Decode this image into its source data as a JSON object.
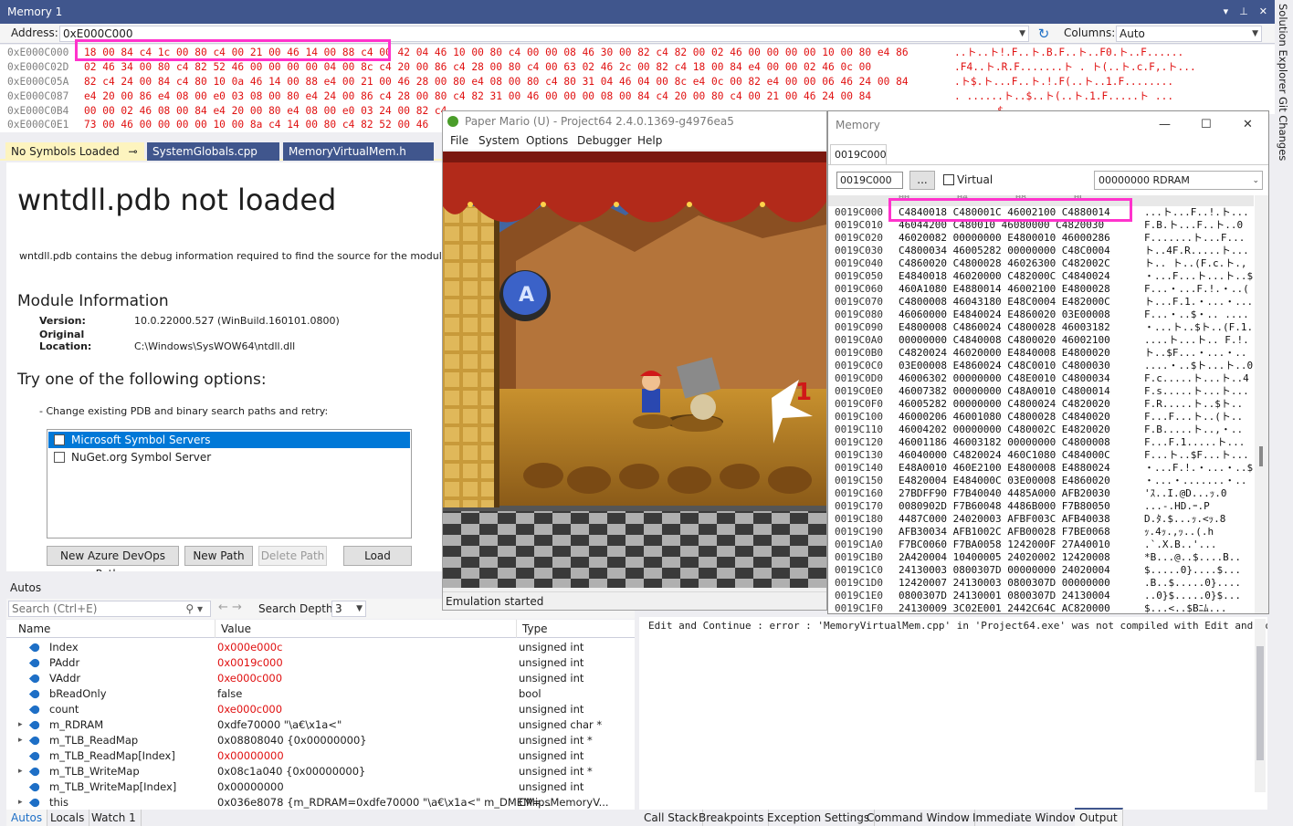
{
  "memory1": {
    "title": "Memory 1",
    "address_label": "Address:",
    "address_value": "0xE000C000",
    "columns_label": "Columns:",
    "columns_value": "Auto",
    "rows": [
      {
        "addr": "0xE000C000",
        "bytes": "18 00 84 c4 1c 00 80 c4 00 21 00 46 14 00 88 c4 00 42 04 46 10 00 80 c4 00 00 08 46 30 00 82 c4 82 00 02 46 00 00 00 00 10 00 80 e4 86",
        "chars": "..ト..ト!.F..ト.B.F..ト..F0.ト..F......"
      },
      {
        "addr": "0xE000C02D",
        "bytes": "02 46 34 00 80 c4 82 52 46 00 00 00 00 04 00 8c c4 20 00 86 c4 28 00 80 c4 00 63 02 46 2c 00 82 c4 18 00 84 e4 00 00 02 46 0c 00",
        "chars": ".F4..ト.R.F.......ト . ト(..ト.c.F,.ト..."
      },
      {
        "addr": "0xE000C05A",
        "bytes": "82 c4 24 00 84 c4 80 10 0a 46 14 00 88 e4 00 21 00 46 28 00 80 e4 08 00 80 c4 80 31 04 46 04 00 8c e4 0c 00 82 e4 00 00 06 46 24 00 84",
        "chars": ".ト$.ト...F..ト.!.F(..ト..1.F........"
      },
      {
        "addr": "0xE000C087",
        "bytes": "e4 20 00 86 e4 08 00 e0 03 08 00 80 e4 24 00 86 c4 28 00 80 c4 82 31 00 46 00 00 00 08 00 84 c4 20 00 80 c4 00 21 00 46 24 00 84",
        "chars": ". ......ト..$..ト(..ト.1.F.....ト ..."
      },
      {
        "addr": "0xE000C0B4",
        "bytes": "00 00 02 46 08 00 84 e4 20 00 80 e4 08 00 e0 03 24 00 82 c4",
        "chars": ".......$......"
      },
      {
        "addr": "0xE000C0E1",
        "bytes": "73 00 46 00 00 00 00 10 00 8a c4 14 00 80 c4 82 52 00 46",
        "chars": "s.F......ト...ト.R.F"
      }
    ]
  },
  "doc_tabs": [
    {
      "label": "No Symbols Loaded"
    },
    {
      "label": "SystemGlobals.cpp"
    },
    {
      "label": "MemoryVirtualMem.h"
    }
  ],
  "nosymbols": {
    "title": "wntdll.pdb not loaded",
    "description": "wntdll.pdb contains the debug information required to find the source for the module n",
    "module_info_heading": "Module Information",
    "version_label": "Version:",
    "version_value": "10.0.22000.527 (WinBuild.160101.0800)",
    "location_label": "Original Location:",
    "location_value": "C:\\Windows\\SysWOW64\\ntdll.dll",
    "options_heading": "Try one of the following options:",
    "change_pdb": "-  Change existing PDB and binary search paths and retry:",
    "symbol_servers": [
      "Microsoft Symbol Servers",
      "NuGet.org Symbol Server"
    ],
    "buttons": {
      "devops": "New Azure DevOps Path...",
      "new_path": "New Path",
      "delete_path": "Delete Path",
      "load": "Load"
    }
  },
  "autos": {
    "title": "Autos",
    "search_placeholder": "Search (Ctrl+E)",
    "depth_label": "Search Depth:",
    "depth_value": "3",
    "columns": [
      "Name",
      "Value",
      "Type"
    ],
    "rows": [
      {
        "name": "Index",
        "value": "0x000e000c",
        "type": "unsigned int",
        "red": true,
        "expand": ""
      },
      {
        "name": "PAddr",
        "value": "0x0019c000",
        "type": "unsigned int",
        "red": true,
        "expand": ""
      },
      {
        "name": "VAddr",
        "value": "0xe000c000",
        "type": "unsigned int",
        "red": true,
        "expand": ""
      },
      {
        "name": "bReadOnly",
        "value": "false",
        "type": "bool",
        "red": false,
        "expand": ""
      },
      {
        "name": "count",
        "value": "0xe000c000",
        "type": "unsigned int",
        "red": true,
        "expand": ""
      },
      {
        "name": "m_RDRAM",
        "value": "0xdfe70000 \"\\a€\\x1a<\"",
        "type": "unsigned char *",
        "red": false,
        "expand": "▸"
      },
      {
        "name": "m_TLB_ReadMap",
        "value": "0x08808040 {0x00000000}",
        "type": "unsigned int *",
        "red": false,
        "expand": "▸"
      },
      {
        "name": "m_TLB_ReadMap[Index]",
        "value": "0x00000000",
        "type": "unsigned int",
        "red": true,
        "expand": ""
      },
      {
        "name": "m_TLB_WriteMap",
        "value": "0x08c1a040 {0x00000000}",
        "type": "unsigned int *",
        "red": false,
        "expand": "▸"
      },
      {
        "name": "m_TLB_WriteMap[Index]",
        "value": "0x00000000",
        "type": "unsigned int",
        "red": false,
        "expand": ""
      },
      {
        "name": "this",
        "value": "0x036e8078 {m_RDRAM=0xdfe70000 \"\\a€\\x1a<\" m_DMEM=...",
        "type": "CMipsMemoryV...",
        "red": false,
        "expand": "▸"
      }
    ],
    "tabs": [
      "Autos",
      "Locals",
      "Watch 1"
    ]
  },
  "output": {
    "line": "Edit and Continue : error  : 'MemoryVirtualMem.cpp' in 'Project64.exe' was not compiled with Edit and Continue"
  },
  "bottom_tabs": [
    "Call Stack",
    "Breakpoints",
    "Exception Settings",
    "Command Window",
    "Immediate Window",
    "Output"
  ],
  "side_tabs": [
    "Solution Explorer",
    "Git Changes"
  ],
  "pj64": {
    "title": "Paper Mario (U) - Project64 2.4.0.1369-g4976ea5",
    "menu": [
      "File",
      "System",
      "Options",
      "Debugger",
      "Help"
    ],
    "status": "Emulation started"
  },
  "memwin": {
    "title": "Memory",
    "tab": "0019C000",
    "address": "0019C000",
    "dots": "...",
    "virtual_label": "Virtual",
    "region": "00000000 RDRAM",
    "col_headers": [
      "00",
      "04",
      "08",
      "0C"
    ],
    "rows": [
      {
        "addr": "0019C000",
        "data": "C4840018 C480001C 46002100 C4880014",
        "chars": "...ト...F..!.ト..."
      },
      {
        "addr": "0019C010",
        "data": "46044200 C480010 46080000 C4820030",
        "chars": "F.B.ト...F..ト..0"
      },
      {
        "addr": "0019C020",
        "data": "46020082 00000000 E4800010 46000286",
        "chars": "F.......ト...F..."
      },
      {
        "addr": "0019C030",
        "data": "C4800034 46005282 00000000 C48C0004",
        "chars": "ト..4F.R.....ト..."
      },
      {
        "addr": "0019C040",
        "data": "C4860020 C4800028 46026300 C482002C",
        "chars": "ト.. ト..(F.c.ト.,"
      },
      {
        "addr": "0019C050",
        "data": "E4840018 46020000 C482000C C4840024",
        "chars": "・...F...ト...ト..$"
      },
      {
        "addr": "0019C060",
        "data": "460A1080 E4880014 46002100 E4800028",
        "chars": "F...・...F.!.・..("
      },
      {
        "addr": "0019C070",
        "data": "C4800008 46043180 E48C0004 E482000C",
        "chars": "ト...F.1.・...・..."
      },
      {
        "addr": "0019C080",
        "data": "46060000 E4840024 E4860020 03E00008",
        "chars": "F...・..$・.. ...."
      },
      {
        "addr": "0019C090",
        "data": "E4800008 C4860024 C4800028 46003182",
        "chars": "・...ト..$ト..(F.1."
      },
      {
        "addr": "0019C0A0",
        "data": "00000000 C4840008 C4800020 46002100",
        "chars": "....ト...ト.. F.!."
      },
      {
        "addr": "0019C0B0",
        "data": "C4820024 46020000 E4840008 E4800020",
        "chars": "ト..$F...・...・.. "
      },
      {
        "addr": "0019C0C0",
        "data": "03E00008 E4860024 C48C0010 C4800030",
        "chars": "....・..$ト...ト..0"
      },
      {
        "addr": "0019C0D0",
        "data": "46006302 00000000 C48E0010 C4800034",
        "chars": "F.c.....ト...ト..4"
      },
      {
        "addr": "0019C0E0",
        "data": "46007382 00000000 C48A0010 C4800014",
        "chars": "F.s.....ト...ト..."
      },
      {
        "addr": "0019C0F0",
        "data": "46005282 00000000 C4800024 C4820020",
        "chars": "F.R.....ト..$ト.. "
      },
      {
        "addr": "0019C100",
        "data": "46000206 46001080 C4800028 C4840020",
        "chars": "F...F...ト..(ト.. "
      },
      {
        "addr": "0019C110",
        "data": "46004202 00000000 C480002C E4820020",
        "chars": "F.B.....ト..,・.. "
      },
      {
        "addr": "0019C120",
        "data": "46001186 46003182 00000000 C4800008",
        "chars": "F...F.1.....ト..."
      },
      {
        "addr": "0019C130",
        "data": "46040000 C4820024 460C1080 C484000C",
        "chars": "F...ト..$F...ト..."
      },
      {
        "addr": "0019C140",
        "data": "E48A0010 460E2100 E4800008 E4880024",
        "chars": "・...F.!.・...・..$"
      },
      {
        "addr": "0019C150",
        "data": "E4820004 E484000C 03E00008 E4860020",
        "chars": "・...・.......・.. "
      },
      {
        "addr": "0019C160",
        "data": "27BDFF90 F7B40040 4485A000 AFB20030",
        "chars": "'ｽ..I.@D...ｯ.0"
      },
      {
        "addr": "0019C170",
        "data": "0080902D F7B60048 4486B000 F7B80050",
        "chars": "...-.HD.ｰ.P"
      },
      {
        "addr": "0019C180",
        "data": "4487C000 24020003 AFBF003C AFB40038",
        "chars": "D.ﾀ.$...ｯ.<ｯ.8"
      },
      {
        "addr": "0019C190",
        "data": "AFB30034 AFB1002C AFB00028 F7BE0068",
        "chars": "ｯ.4ｯ.,ｯ..(.h"
      },
      {
        "addr": "0019C1A0",
        "data": "F7BC0060 F7BA0058 1242000F 27A40010",
        "chars": ".`.X.B..'..."
      },
      {
        "addr": "0019C1B0",
        "data": "2A420004 10400005 24020002 12420008",
        "chars": "*B...@..$....B.."
      },
      {
        "addr": "0019C1C0",
        "data": "24130003 0800307D 00000000 24020004",
        "chars": "$.....0}....$..."
      },
      {
        "addr": "0019C1D0",
        "data": "12420007 24130003 0800307D 00000000",
        "chars": ".B..$.....0}...."
      },
      {
        "addr": "0019C1E0",
        "data": "0800307D 24130001 0800307D 24130004",
        "chars": "..0}$.....0}$..."
      },
      {
        "addr": "0019C1F0",
        "data": "24130009 3C02E001 2442C64C AC820000",
        "chars": "$...<..$Bﾆﾑ..."
      }
    ]
  }
}
